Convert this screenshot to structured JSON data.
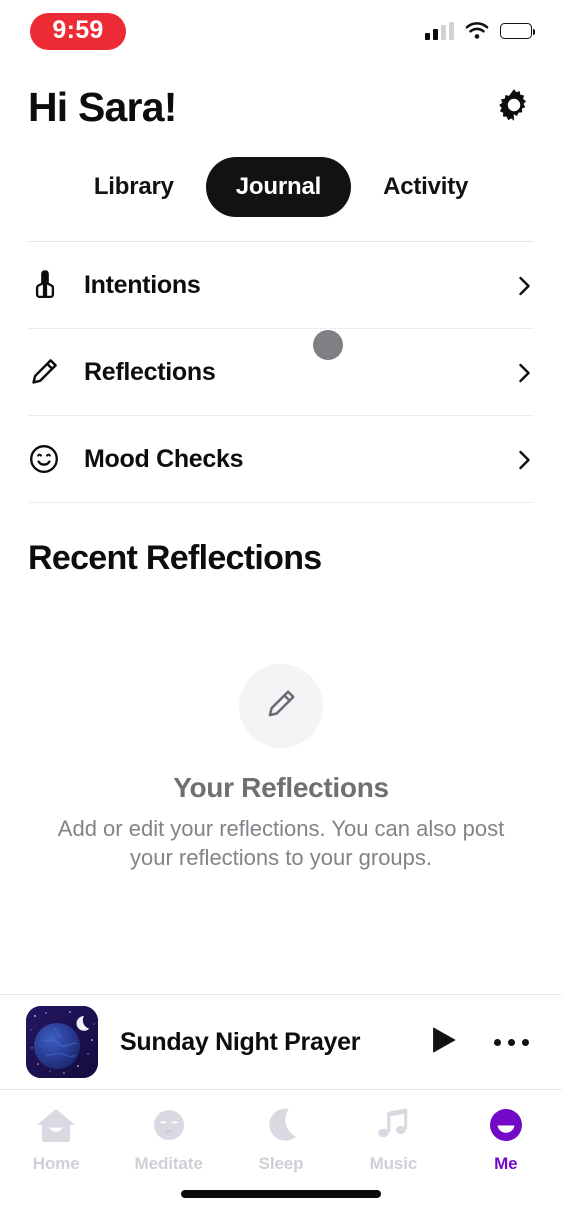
{
  "status_bar": {
    "time": "9:59",
    "time_pill_color": "#ED2B35",
    "cellular_icon": "cellular-bars-icon",
    "wifi_icon": "wifi-icon",
    "battery_icon": "battery-icon"
  },
  "header": {
    "greeting": "Hi Sara!",
    "settings_icon": "gear-icon"
  },
  "tabs": [
    {
      "label": "Library",
      "active": false
    },
    {
      "label": "Journal",
      "active": true
    },
    {
      "label": "Activity",
      "active": false
    }
  ],
  "menu": {
    "rows": [
      {
        "label": "Intentions",
        "icon": "praying-hands-icon"
      },
      {
        "label": "Reflections",
        "icon": "pencil-icon"
      },
      {
        "label": "Mood Checks",
        "icon": "smiley-face-icon"
      }
    ],
    "chevron_icon": "chevron-right-icon"
  },
  "recent": {
    "section_title": "Recent Reflections",
    "empty_icon": "pencil-icon",
    "empty_title": "Your Reflections",
    "empty_subtitle": "Add or edit your reflections. You can also post your reflections to your groups."
  },
  "player": {
    "artwork_alt": "night-earth-artwork",
    "title": "Sunday Night Prayer",
    "play_icon": "play-icon",
    "more_icon": "more-dots-icon"
  },
  "tabbar": {
    "accent_color": "#7209C7",
    "items": [
      {
        "label": "Home",
        "icon": "home-smile-icon",
        "active": false
      },
      {
        "label": "Meditate",
        "icon": "meditate-face-icon",
        "active": false
      },
      {
        "label": "Sleep",
        "icon": "moon-icon",
        "active": false
      },
      {
        "label": "Music",
        "icon": "music-note-icon",
        "active": false
      },
      {
        "label": "Me",
        "icon": "me-smile-icon",
        "active": true
      }
    ]
  },
  "cursor": {
    "shape": "circle",
    "color": "#808084"
  }
}
